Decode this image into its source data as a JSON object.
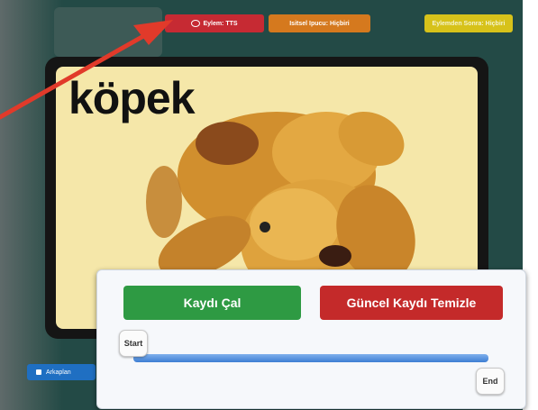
{
  "top_bar": {
    "tts_button": "Eylem: TTS",
    "hint_button": "Isitsel Ipucu: Hiçbiri",
    "after_button": "Eylemden Sonra: Hiçbiri"
  },
  "card": {
    "word": "köpek",
    "image": "teddy-bear-dog-photo"
  },
  "background_button": "Arkaplan",
  "recorder": {
    "play_label": "Kaydı Çal",
    "clear_label": "Güncel Kaydı Temizle",
    "start_label": "Start",
    "end_label": "End"
  },
  "colors": {
    "app_bg": "#234a46",
    "tts_red": "#c62a33",
    "hint_orange": "#d5791e",
    "after_yellow": "#d7c21a",
    "play_green": "#2e9a43",
    "clear_red": "#c42a2a",
    "arrow_red": "#e13a2a"
  }
}
